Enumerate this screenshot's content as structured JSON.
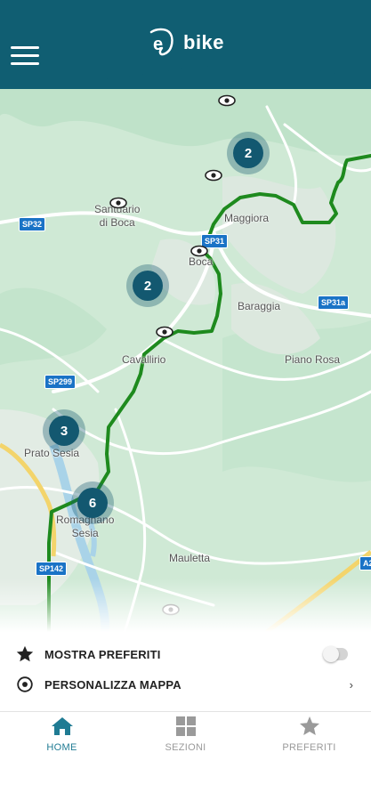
{
  "header": {
    "logo_letter": "e",
    "logo_text": "bike",
    "bg_color": "#105e72"
  },
  "map": {
    "places": [
      {
        "id": "santuario",
        "label": "Santuario\ndi Boca"
      },
      {
        "id": "maggiora",
        "label": "Maggiora"
      },
      {
        "id": "boca",
        "label": "Boca"
      },
      {
        "id": "baraggia",
        "label": "Baraggia"
      },
      {
        "id": "cavallirio",
        "label": "Cavallirio"
      },
      {
        "id": "piano-rosa",
        "label": "Piano Rosa"
      },
      {
        "id": "prato-sesia",
        "label": "Prato Sesia"
      },
      {
        "id": "romagnano",
        "label": "Romagnano\nSesia"
      },
      {
        "id": "mauletta",
        "label": "Mauletta"
      }
    ],
    "roads": [
      "SP32",
      "SP31",
      "SP31a",
      "SP299",
      "SP142",
      "A2"
    ],
    "clusters": [
      {
        "id": "top",
        "count": "2"
      },
      {
        "id": "mid",
        "count": "2"
      },
      {
        "id": "left",
        "count": "3"
      },
      {
        "id": "bottom",
        "count": "6"
      }
    ],
    "route_color": "#1e8a1e",
    "cluster_color": "#135870"
  },
  "options": {
    "favorites_label": "MOSTRA PREFERITI",
    "favorites_toggle": false,
    "customize_label": "PERSONALIZZA MAPPA",
    "customize_chevron": "›"
  },
  "tabs": [
    {
      "label": "HOME",
      "icon": "home-icon",
      "active": true
    },
    {
      "label": "SEZIONI",
      "icon": "grid-icon",
      "active": false
    },
    {
      "label": "PREFERITI",
      "icon": "star-icon",
      "active": false
    }
  ],
  "colors": {
    "accent": "#1f7b93",
    "inactive": "#9a9a9a"
  }
}
